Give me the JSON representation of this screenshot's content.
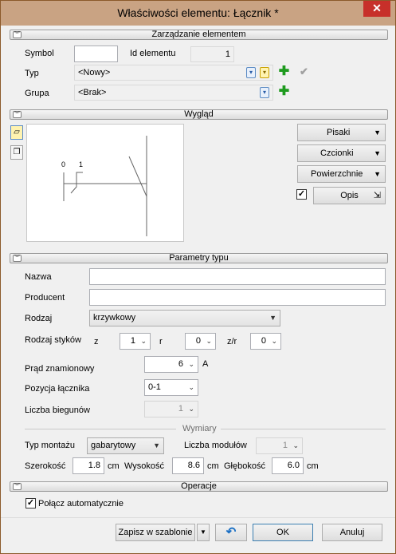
{
  "window": {
    "title": "Właściwości elementu: Łącznik *",
    "close_glyph": "✕"
  },
  "sections": {
    "manage": "Zarządzanie elementem",
    "appearance": "Wygląd",
    "type_params": "Parametry typu",
    "dimensions": "Wymiary",
    "operations": "Operacje"
  },
  "manage": {
    "symbol_label": "Symbol",
    "symbol_value": "",
    "id_label": "Id elementu",
    "id_value": "1",
    "type_label": "Typ",
    "type_value": "<Nowy>",
    "group_label": "Grupa",
    "group_value": "<Brak>"
  },
  "preview": {
    "label_0": "0",
    "label_1": "1"
  },
  "appearance": {
    "pens_label": "Pisaki",
    "fonts_label": "Czcionki",
    "surfaces_label": "Powierzchnie",
    "description_label": "Opis",
    "description_checked": true
  },
  "type_params": {
    "name_label": "Nazwa",
    "name_value": "",
    "producer_label": "Producent",
    "producer_value": "",
    "kind_label": "Rodzaj",
    "kind_value": "krzywkowy",
    "contacts_label": "Rodzaj styków",
    "z_label": "z",
    "z_value": "1",
    "r_label": "r",
    "r_value": "0",
    "zr_label": "z/r",
    "zr_value": "0",
    "rated_current_label": "Prąd znamionowy",
    "rated_current_value": "6",
    "rated_current_unit": "A",
    "switch_position_label": "Pozycja łącznika",
    "switch_position_value": "0-1",
    "poles_label": "Liczba biegunów",
    "poles_value": "1"
  },
  "dimensions": {
    "mount_label": "Typ montażu",
    "mount_value": "gabarytowy",
    "modules_label": "Liczba modułów",
    "modules_value": "1",
    "width_label": "Szerokość",
    "width_value": "1.8",
    "height_label": "Wysokość",
    "height_value": "8.6",
    "depth_label": "Głębokość",
    "depth_value": "6.0",
    "unit": "cm"
  },
  "operations": {
    "auto_connect_label": "Połącz automatycznie",
    "auto_connect_checked": true
  },
  "footer": {
    "save_template_label": "Zapisz w szablonie",
    "ok_label": "OK",
    "cancel_label": "Anuluj"
  },
  "colors": {
    "titlebar": "#c9a383",
    "close": "#c7302a",
    "plus": "#1e9a1e"
  }
}
